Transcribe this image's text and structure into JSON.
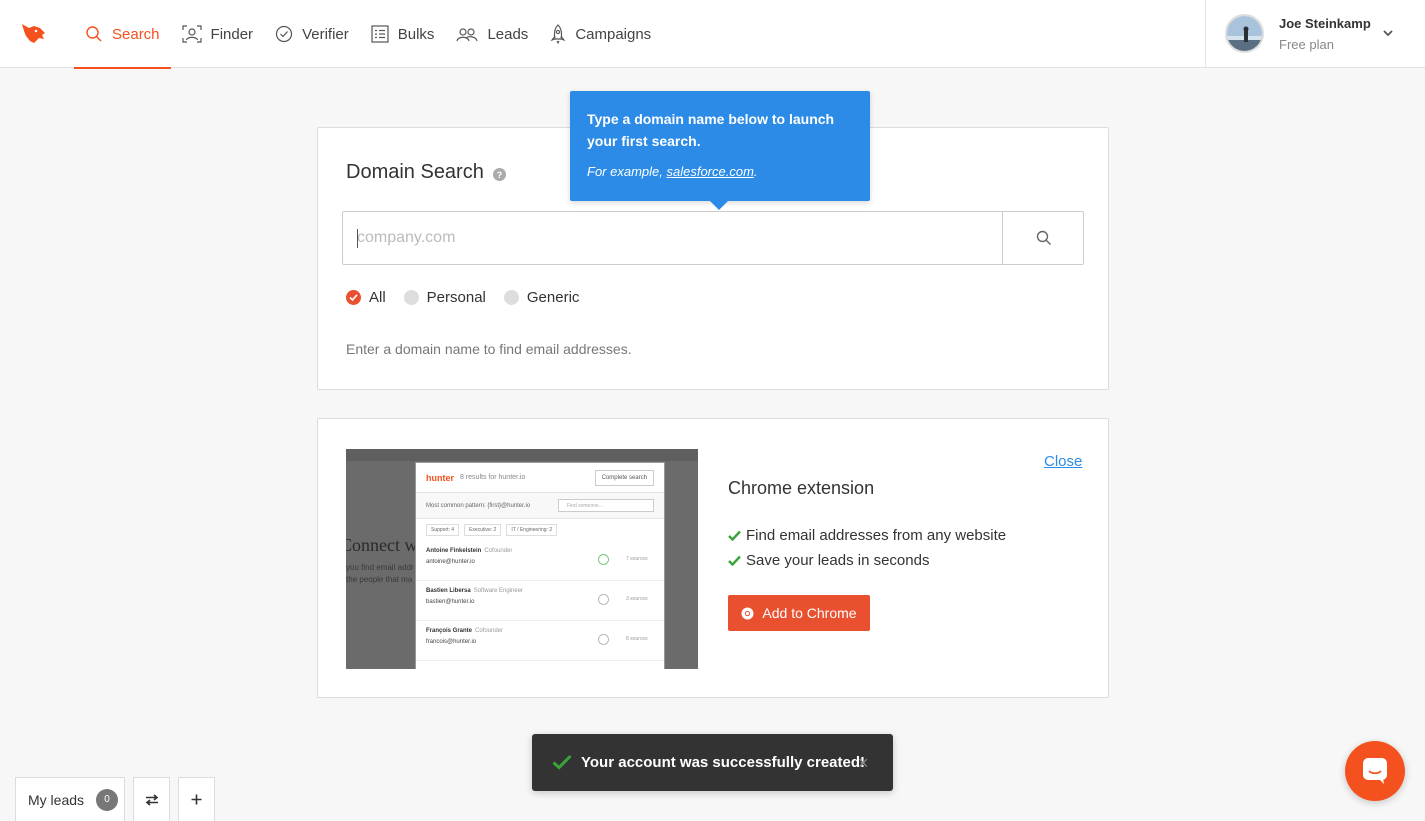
{
  "colors": {
    "accent": "#f4511e",
    "tooltip": "#2b8be6",
    "success": "#3aa33a",
    "toast_bg": "#333333"
  },
  "nav": {
    "items": [
      {
        "label": "Search",
        "icon": "search-icon",
        "active": true
      },
      {
        "label": "Finder",
        "icon": "finder-icon",
        "active": false
      },
      {
        "label": "Verifier",
        "icon": "check-circle-icon",
        "active": false
      },
      {
        "label": "Bulks",
        "icon": "list-icon",
        "active": false
      },
      {
        "label": "Leads",
        "icon": "people-icon",
        "active": false
      },
      {
        "label": "Campaigns",
        "icon": "rocket-icon",
        "active": false
      }
    ]
  },
  "user": {
    "name": "Joe Steinkamp",
    "plan": "Free plan"
  },
  "domain_search": {
    "title": "Domain Search",
    "placeholder": "company.com",
    "value": "",
    "filters": [
      {
        "label": "All",
        "selected": true
      },
      {
        "label": "Personal",
        "selected": false
      },
      {
        "label": "Generic",
        "selected": false
      }
    ],
    "hint": "Enter a domain name to find email addresses."
  },
  "tooltip": {
    "main": "Type a domain name below to launch your first search.",
    "example_prefix": "For example, ",
    "example_link": "salesforce.com",
    "example_suffix": "."
  },
  "extension": {
    "title": "Chrome extension",
    "close_label": "Close",
    "features": [
      "Find email addresses from any website",
      "Save your leads in seconds"
    ],
    "button_label": "Add to Chrome",
    "screenshot": {
      "brand": "hunter",
      "results": "8 results for hunter.io",
      "complete_btn": "Complete search",
      "pattern": "Most common pattern: {first}@hunter.io",
      "find_placeholder": "Find someone...",
      "tags": [
        "Support: 4",
        "Executive: 2",
        "IT / Engineering: 2"
      ],
      "people": [
        {
          "name": "Antoine Finkelstein",
          "title": "Cofounder",
          "email": "antoine@hunter.io",
          "sources": "7 sources"
        },
        {
          "name": "Bastien Libersa",
          "title": "Software Engineer",
          "email": "bastien@hunter.io",
          "sources": "3 sources"
        },
        {
          "name": "François Grante",
          "title": "Cofounder",
          "email": "francois@hunter.io",
          "sources": "8 sources"
        }
      ],
      "bg_heading": "Connect w",
      "bg_line1": "you find email addr",
      "bg_line2": "the people that ma"
    }
  },
  "toast": {
    "message": "Your account was successfully created!"
  },
  "footer": {
    "my_leads_label": "My leads",
    "my_leads_count": "0"
  }
}
